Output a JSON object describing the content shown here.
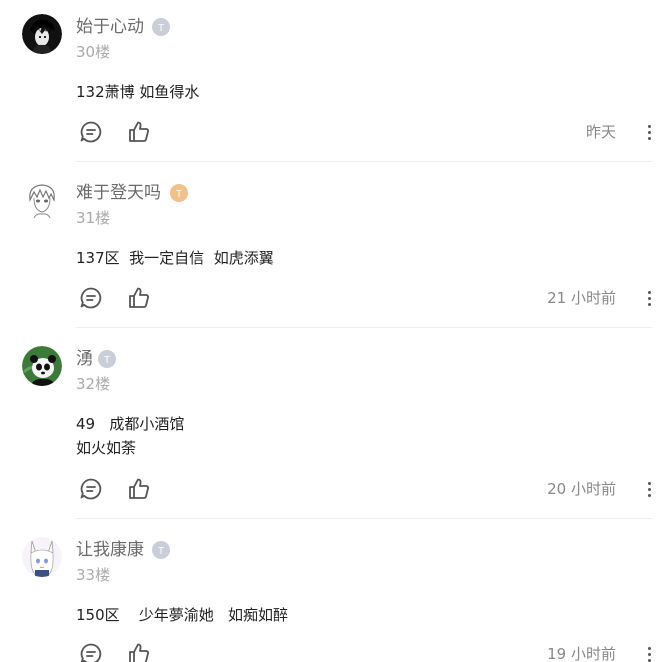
{
  "comments": [
    {
      "username": "始于心动",
      "level_badge": "T",
      "floor": "30楼",
      "content": "132萧博 如鱼得水",
      "time": "昨天"
    },
    {
      "username": "难于登天吗",
      "level_badge": "T",
      "floor": "31楼",
      "content": "137区  我一定自信  如虎添翼",
      "time": "21 小时前"
    },
    {
      "username": "湧",
      "level_badge": "T",
      "floor": "32楼",
      "content": "49   成都小酒馆\n如火如荼",
      "time": "20 小时前"
    },
    {
      "username": "让我康康",
      "level_badge": "T",
      "floor": "33楼",
      "content": "150区    少年夢渝她   如痴如醉",
      "time": "19 小时前"
    }
  ],
  "colors": {
    "badge_gray": "#c9ced8",
    "badge_orange": "#f2c08a",
    "username": "#6b6b6b",
    "floor": "#aaaaaa",
    "divider": "#eeeeee"
  },
  "icons": {
    "reply": "comment-bubble-icon",
    "like": "thumbs-up-icon",
    "more": "more-vertical-icon"
  }
}
